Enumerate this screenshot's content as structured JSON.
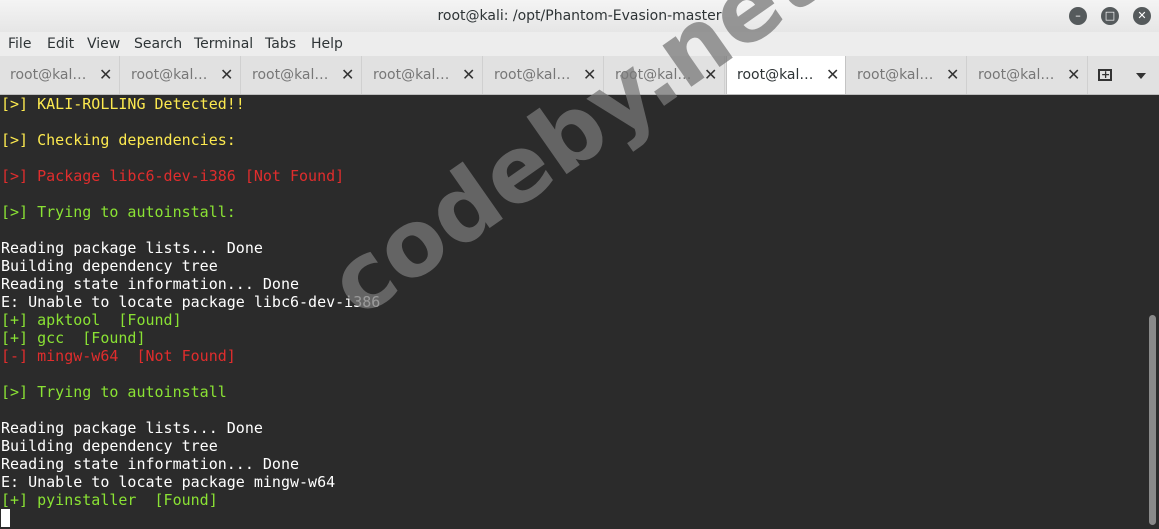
{
  "window": {
    "title": "root@kali: /opt/Phantom-Evasion-master",
    "minimize_glyph": "–",
    "maximize_glyph": "□",
    "close_glyph": "✕"
  },
  "menubar": {
    "items": [
      "File",
      "Edit",
      "View",
      "Search",
      "Terminal",
      "Tabs",
      "Help"
    ]
  },
  "tabs": {
    "items": [
      {
        "label": "root@kal…"
      },
      {
        "label": "root@kal…"
      },
      {
        "label": "root@kal…"
      },
      {
        "label": "root@kal…"
      },
      {
        "label": "root@kal…"
      },
      {
        "label": "root@kal…"
      },
      {
        "label": "root@kal…"
      },
      {
        "label": "root@kal…"
      },
      {
        "label": "root@kal…"
      }
    ],
    "close_glyph": "✕",
    "new_tab_glyph": "+",
    "active_index": 6
  },
  "terminal": {
    "lines": [
      {
        "text": "[>] KALI-ROLLING Detected!!",
        "color": "yellow"
      },
      {
        "text": "",
        "color": "white"
      },
      {
        "text": "[>] Checking dependencies:",
        "color": "yellow"
      },
      {
        "text": "",
        "color": "white"
      },
      {
        "text": "[>] Package libc6-dev-i386 [Not Found]",
        "color": "red"
      },
      {
        "text": "",
        "color": "white"
      },
      {
        "text": "[>] Trying to autoinstall:",
        "color": "green"
      },
      {
        "text": "",
        "color": "white"
      },
      {
        "text": "Reading package lists... Done",
        "color": "white"
      },
      {
        "text": "Building dependency tree",
        "color": "white"
      },
      {
        "text": "Reading state information... Done",
        "color": "white"
      },
      {
        "text": "E: Unable to locate package libc6-dev-i386",
        "color": "white"
      },
      {
        "text": "[+] apktool  [Found]",
        "color": "green"
      },
      {
        "text": "[+] gcc  [Found]",
        "color": "green"
      },
      {
        "text": "[-] mingw-w64  [Not Found]",
        "color": "red"
      },
      {
        "text": "",
        "color": "white"
      },
      {
        "text": "[>] Trying to autoinstall",
        "color": "green"
      },
      {
        "text": "",
        "color": "white"
      },
      {
        "text": "Reading package lists... Done",
        "color": "white"
      },
      {
        "text": "Building dependency tree",
        "color": "white"
      },
      {
        "text": "Reading state information... Done",
        "color": "white"
      },
      {
        "text": "E: Unable to locate package mingw-w64",
        "color": "white"
      },
      {
        "text": "[+] pyinstaller  [Found]",
        "color": "green"
      }
    ]
  },
  "watermark": {
    "text": "codeby.net"
  },
  "colors": {
    "terminal_bg": "#2b2b2b",
    "yellow": "#fce94f",
    "red": "#e02d2d",
    "green": "#8ae234",
    "white": "#ffffff"
  }
}
